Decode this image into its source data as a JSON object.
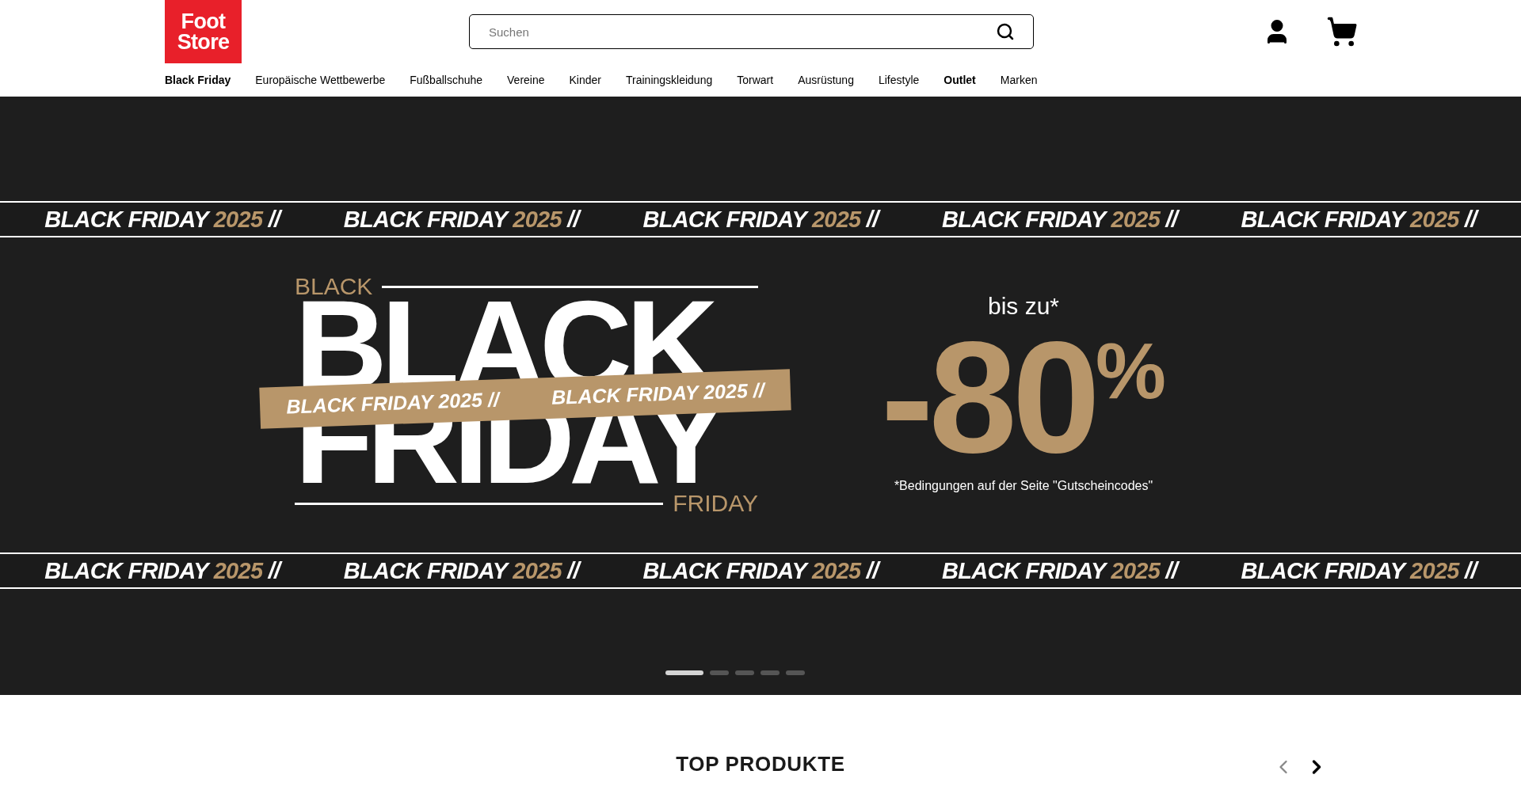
{
  "header": {
    "logo": [
      "Foot",
      "Store"
    ],
    "search": {
      "placeholder": "Suchen"
    }
  },
  "nav": [
    {
      "label": "Black Friday",
      "bold": true
    },
    {
      "label": "Europäische Wettbewerbe",
      "bold": false
    },
    {
      "label": "Fußballschuhe",
      "bold": false
    },
    {
      "label": "Vereine",
      "bold": false
    },
    {
      "label": "Kinder",
      "bold": false
    },
    {
      "label": "Trainingskleidung",
      "bold": false
    },
    {
      "label": "Torwart",
      "bold": false
    },
    {
      "label": "Ausrüstung",
      "bold": false
    },
    {
      "label": "Lifestyle",
      "bold": false
    },
    {
      "label": "Outlet",
      "bold": true
    },
    {
      "label": "Marken",
      "bold": false
    }
  ],
  "banner": {
    "strip_top": [
      {
        "label": "BLACK FRIDAY",
        "year": "2025",
        "sep": "//"
      },
      {
        "label": "BLACK FRIDAY",
        "year": "2025",
        "sep": "//"
      },
      {
        "label": "BLACK FRIDAY",
        "year": "2025",
        "sep": "//"
      },
      {
        "label": "BLACK FRIDAY",
        "year": "2025",
        "sep": "//"
      },
      {
        "label": "BLACK FRIDAY",
        "year": "2025",
        "sep": "//"
      }
    ],
    "kicker_top": "BLACK",
    "headline": [
      "BLACK",
      "FRIDAY"
    ],
    "tape": [
      {
        "label": "BLACK FRIDAY 2025",
        "sep": "//"
      },
      {
        "label": "BLACK FRIDAY 2025",
        "sep": "//"
      }
    ],
    "kicker_bottom": "FRIDAY",
    "lead": "bis zu*",
    "discount": "-80",
    "percent": "%",
    "footnote": "*Bedingungen auf der Seite \"Gutscheincodes\"",
    "strip_bottom": [
      {
        "label": "BLACK FRIDAY",
        "year": "2025",
        "sep": "//"
      },
      {
        "label": "BLACK FRIDAY",
        "year": "2025",
        "sep": "//"
      },
      {
        "label": "BLACK FRIDAY",
        "year": "2025",
        "sep": "//"
      },
      {
        "label": "BLACK FRIDAY",
        "year": "2025",
        "sep": "//"
      },
      {
        "label": "BLACK FRIDAY",
        "year": "2025",
        "sep": "//"
      }
    ],
    "slides": [
      {
        "selected": true
      },
      {
        "selected": false
      },
      {
        "selected": false
      },
      {
        "selected": false
      },
      {
        "selected": false
      }
    ]
  },
  "section": {
    "title": "TOP PRODUKTE",
    "prev": {
      "disabled": true
    },
    "next": {
      "disabled": false
    }
  }
}
